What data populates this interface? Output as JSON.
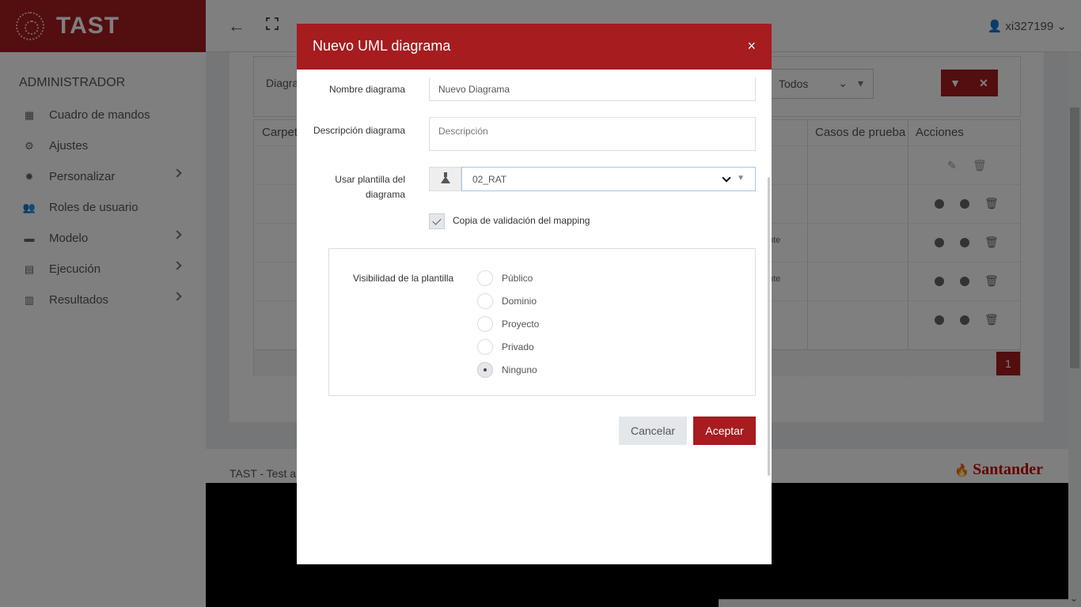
{
  "app": {
    "brand": "TAST",
    "user": "xi327199",
    "sidebar": {
      "section": "ADMINISTRADOR",
      "items": [
        {
          "label": "Cuadro de mandos",
          "icon": "dashboard-icon"
        },
        {
          "label": "Ajustes",
          "icon": "gear-icon"
        },
        {
          "label": "Personalizar",
          "icon": "gear-icon"
        },
        {
          "label": "Roles de usuario",
          "icon": "users-icon"
        },
        {
          "label": "Modelo",
          "icon": "briefcase-icon"
        },
        {
          "label": "Ejecución",
          "icon": "calendar-icon"
        },
        {
          "label": "Resultados",
          "icon": "chart-icon"
        }
      ]
    },
    "filter": {
      "label": "Diagra",
      "todos": "Todos"
    },
    "table": {
      "headers": [
        "Carpeta",
        "Casos de prueba",
        "Acciones"
      ],
      "badge_text": "nte",
      "page": "1"
    },
    "footer": {
      "text": "TAST - Test a",
      "logo": "Santander"
    }
  },
  "modal": {
    "title": "Nuevo UML diagrama",
    "close": "×",
    "fields": {
      "name_label": "Nombre diagrama",
      "name_value": "Nuevo Diagrama",
      "desc_label": "Descripción diagrama",
      "desc_placeholder": "Descripción",
      "template_label_1": "Usar plantilla del",
      "template_label_2": "diagrama",
      "template_value": "02_RAT"
    },
    "checkbox": {
      "label": "Copia de validación del mapping",
      "checked": true
    },
    "visibility": {
      "label": "Visibilidad de la plantilla",
      "options": [
        "Público",
        "Dominio",
        "Proyecto",
        "Privado",
        "Ninguno"
      ],
      "selected": "Ninguno"
    },
    "buttons": {
      "cancel": "Cancelar",
      "ok": "Aceptar"
    }
  }
}
